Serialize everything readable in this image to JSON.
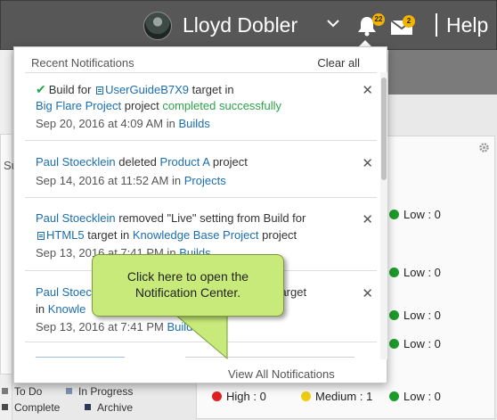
{
  "header": {
    "username": "Lloyd Dobler",
    "notification_count": "22",
    "message_count": "2",
    "help_label": "Help"
  },
  "notifications": {
    "title": "Recent Notifications",
    "clear_label": "Clear all",
    "view_all_label": "View All Notifications",
    "items": [
      {
        "icon": "checkmark-icon",
        "text1": "Build for",
        "project_icon": "build-icon",
        "link1": "UserGuideB7X9",
        "text2": "target in",
        "link2": "Big Flare Project",
        "text3": "project",
        "status": "completed successfully",
        "date": "Sep 20, 2016 at 4:09 AM in",
        "category": "Builds"
      },
      {
        "user": "Paul Stoecklein",
        "text1": "deleted",
        "link1": "Product A",
        "text2": "project",
        "date": "Sep 14, 2016 at 11:52 AM in",
        "category": "Projects"
      },
      {
        "user": "Paul Stoecklein",
        "text1": "removed \"Live\" setting from Build for",
        "project_icon": "build-icon",
        "link1": "HTML5",
        "text2": "target in",
        "link2": "Knowledge Base Project",
        "text3": "project",
        "date": "Sep 13, 2016 at 7:41 PM in",
        "category": "Builds"
      },
      {
        "user": "Paul Stoec",
        "text_tail": "5 target",
        "link_start": "in",
        "link2": "Knowle",
        "date": "Sep 13, 2016 at 7:41 PM",
        "category": "Builds"
      }
    ]
  },
  "callout": {
    "line1": "Click here to open the",
    "line2": "Notification Center."
  },
  "background": {
    "left_label": "Su",
    "low_labels": [
      "Low : 0",
      "Low : 0",
      "Low : 0",
      "Low : 0"
    ],
    "legend": [
      {
        "label": "To Do",
        "color": "#7a7a7a"
      },
      {
        "label": "In Progress",
        "color": "#7d92b4"
      },
      {
        "label": "Complete",
        "color": "#4c4c4c"
      },
      {
        "label": "Archive",
        "color": "#2c3a55"
      }
    ],
    "bottom": {
      "high": "High : 0",
      "medium": "Medium : 1",
      "low": "Low : 0"
    }
  },
  "colors": {
    "link": "#1b6eb0",
    "success": "#2da34a",
    "badge": "#f2b200",
    "callout": "#c8ea7a",
    "high": "#e02020",
    "medium": "#f0cc10",
    "low": "#1c9a2a"
  }
}
